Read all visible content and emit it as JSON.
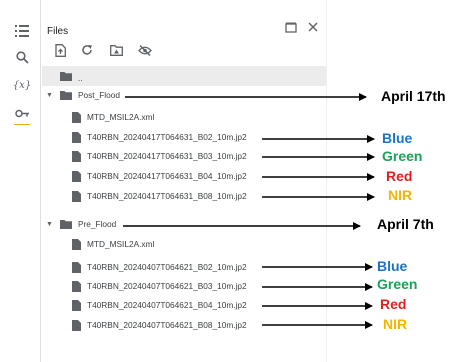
{
  "panel": {
    "title": "Files",
    "parent_label": ".."
  },
  "tree": {
    "post_flood": {
      "label": "Post_Flood",
      "meta": "MTD_MSIL2A.xml",
      "files": [
        "T40RBN_20240417T064631_B02_10m.jp2",
        "T40RBN_20240417T064631_B03_10m.jp2",
        "T40RBN_20240417T064631_B04_10m.jp2",
        "T40RBN_20240417T064631_B08_10m.jp2"
      ]
    },
    "pre_flood": {
      "label": "Pre_Flood",
      "meta": "MTD_MSIL2A.xml",
      "files": [
        "T40RBN_20240407T064621_B02_10m.jp2",
        "T40RBN_20240407T064621_B03_10m.jp2",
        "T40RBN_20240407T064621_B04_10m.jp2",
        "T40RBN_20240407T064621_B08_10m.jp2"
      ]
    }
  },
  "annotations": {
    "post_date": "April 17th",
    "pre_date": "April 7th",
    "bands": [
      {
        "label": "Blue",
        "color": "#1a73c8"
      },
      {
        "label": "Green",
        "color": "#19a35a"
      },
      {
        "label": "Red",
        "color": "#e02020"
      },
      {
        "label": "NIR",
        "color": "#f5b400"
      }
    ]
  }
}
